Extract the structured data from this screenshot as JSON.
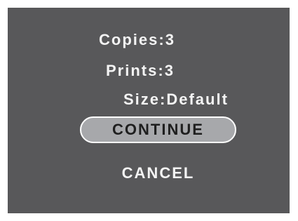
{
  "settings": {
    "copies": {
      "label": "Copies:",
      "value": "3"
    },
    "prints": {
      "label": "Prints:",
      "value": "3"
    },
    "size": {
      "label": "Size:",
      "value": "Default"
    }
  },
  "actions": {
    "continue_label": "CONTINUE",
    "cancel_label": "CANCEL"
  },
  "colors": {
    "screen_background": "#58585a",
    "selected_button_fill": "#a7a8ab",
    "text": "#f4f4f4"
  }
}
